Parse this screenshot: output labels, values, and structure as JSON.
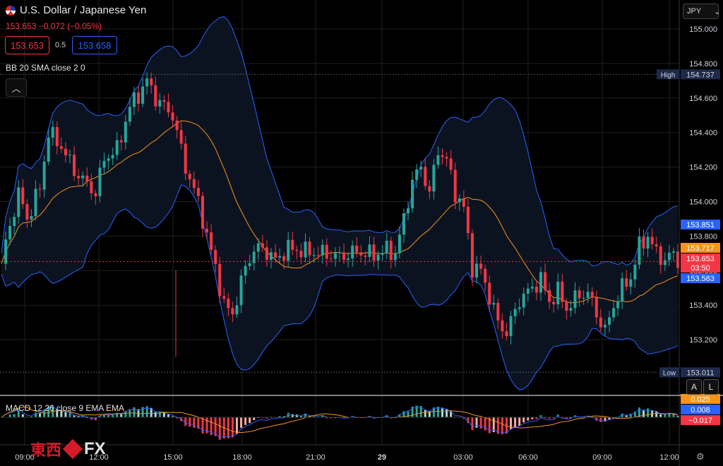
{
  "header": {
    "symbol_name": "U.S. Dollar / Japanese Yen",
    "last": "153.653",
    "change": "−0.072",
    "change_pct": "(−0.05%)",
    "bid": "153.653",
    "spread": "0.5",
    "ask": "153.658",
    "currency": "JPY"
  },
  "indicators": {
    "bb_label": "BB 20 SMA close 2 0",
    "macd_label": "MACD 12 26 close 9 EMA EMA",
    "collapse_icon": "chevron-up-icon"
  },
  "price_scale": {
    "ticks": [
      "155.000",
      "154.800",
      "154.600",
      "154.400",
      "154.200",
      "154.000",
      "153.800",
      "153.600",
      "153.400",
      "153.200"
    ],
    "high_label": "High",
    "high_value": "154.737",
    "low_label": "Low",
    "low_value": "153.011",
    "badges": [
      {
        "text": "153.851",
        "color": "#2962ff"
      },
      {
        "text": "153.717",
        "color": "#f7931a"
      },
      {
        "text": "153.653",
        "color": "#f23645"
      },
      {
        "text": "03:50",
        "color": "#f23645"
      },
      {
        "text": "153.583",
        "color": "#2962ff"
      }
    ]
  },
  "macd_scale": {
    "badges": [
      {
        "text": "0.025",
        "color": "#f7931a"
      },
      {
        "text": "0.008",
        "color": "#2962ff"
      },
      {
        "text": "−0.017",
        "color": "#f23645"
      }
    ]
  },
  "buttons": {
    "auto": "A",
    "log": "L"
  },
  "time_axis": [
    "09:00",
    "12:00",
    "15:00",
    "18:00",
    "21:00",
    "29",
    "03:00",
    "06:00",
    "09:00",
    "12:00"
  ],
  "watermark": {
    "jp": "東西",
    "fx": "FX"
  },
  "colors": {
    "up": "#26a69a",
    "down": "#f23645",
    "bands": "#2962ff",
    "basis": "#f7931a"
  },
  "chart_data": {
    "type": "candlestick",
    "title": "U.S. Dollar / Japanese Yen",
    "ylim": [
      153.0,
      155.05
    ],
    "close_path": [
      [
        0,
        153.64
      ],
      [
        2,
        153.86
      ],
      [
        4,
        154.05
      ],
      [
        6,
        153.9
      ],
      [
        9,
        154.08
      ],
      [
        11,
        154.4
      ],
      [
        14,
        154.32
      ],
      [
        17,
        154.18
      ],
      [
        20,
        154.1
      ],
      [
        22,
        154.05
      ],
      [
        24,
        154.25
      ],
      [
        27,
        154.3
      ],
      [
        30,
        154.55
      ],
      [
        32,
        154.62
      ],
      [
        34,
        154.7
      ],
      [
        36,
        154.6
      ],
      [
        38,
        154.55
      ],
      [
        40,
        154.5
      ],
      [
        43,
        154.2
      ],
      [
        46,
        154.0
      ],
      [
        48,
        153.8
      ],
      [
        50,
        153.62
      ],
      [
        52,
        153.4
      ],
      [
        54,
        153.35
      ],
      [
        57,
        153.62
      ],
      [
        59,
        153.72
      ],
      [
        61,
        153.73
      ],
      [
        64,
        153.66
      ],
      [
        67,
        153.73
      ],
      [
        71,
        153.71
      ],
      [
        75,
        153.7
      ],
      [
        79,
        153.68
      ],
      [
        83,
        153.71
      ],
      [
        87,
        153.69
      ],
      [
        90,
        153.72
      ],
      [
        92,
        153.7
      ],
      [
        94,
        153.9
      ],
      [
        96,
        154.12
      ],
      [
        98,
        154.2
      ],
      [
        100,
        154.05
      ],
      [
        102,
        154.3
      ],
      [
        104,
        154.24
      ],
      [
        106,
        154.05
      ],
      [
        108,
        153.96
      ],
      [
        110,
        153.62
      ],
      [
        112,
        153.6
      ],
      [
        114,
        153.45
      ],
      [
        116,
        153.3
      ],
      [
        118,
        153.24
      ],
      [
        121,
        153.43
      ],
      [
        124,
        153.5
      ],
      [
        126,
        153.55
      ],
      [
        128,
        153.42
      ],
      [
        130,
        153.48
      ],
      [
        132,
        153.38
      ],
      [
        135,
        153.46
      ],
      [
        137,
        153.47
      ],
      [
        139,
        153.35
      ],
      [
        141,
        153.25
      ],
      [
        143,
        153.4
      ],
      [
        145,
        153.5
      ],
      [
        147,
        153.56
      ],
      [
        149,
        153.74
      ],
      [
        151,
        153.8
      ],
      [
        153,
        153.7
      ],
      [
        155,
        153.66
      ],
      [
        157,
        153.7
      ],
      [
        158,
        153.653
      ]
    ],
    "bollinger": {
      "period": 20,
      "stddev": 2
    },
    "macd": {
      "fast": 12,
      "slow": 26,
      "signal": 9
    }
  }
}
